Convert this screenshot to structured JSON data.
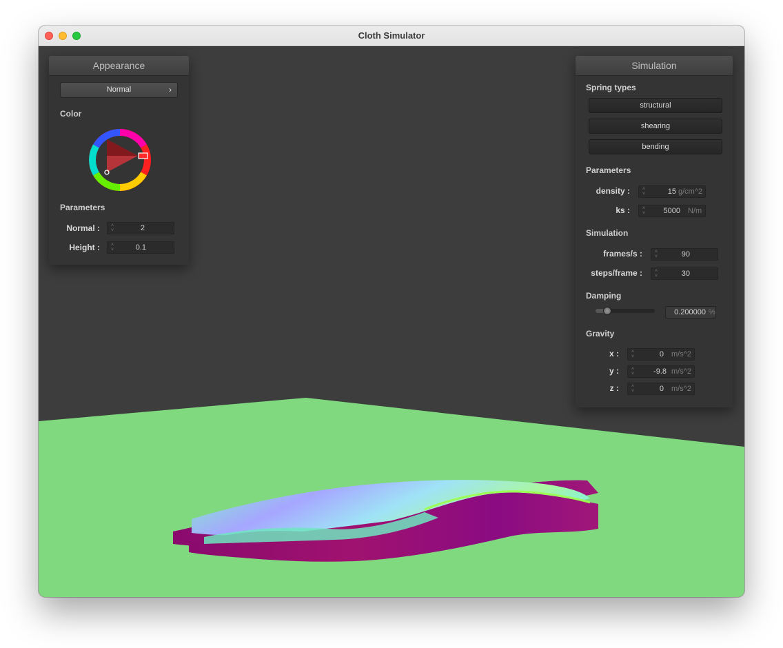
{
  "window": {
    "title": "Cloth Simulator"
  },
  "appearance_panel": {
    "title": "Appearance",
    "shader_dropdown": "Normal",
    "color_label": "Color",
    "parameters_label": "Parameters",
    "normal": {
      "label": "Normal :",
      "value": "2"
    },
    "height": {
      "label": "Height :",
      "value": "0.1"
    }
  },
  "simulation_panel": {
    "title": "Simulation",
    "spring_types_label": "Spring types",
    "spring_buttons": [
      "structural",
      "shearing",
      "bending"
    ],
    "parameters_label": "Parameters",
    "density": {
      "label": "density :",
      "value": "15",
      "unit": "g/cm^2"
    },
    "ks": {
      "label": "ks :",
      "value": "5000",
      "unit": "N/m"
    },
    "simulation_label": "Simulation",
    "frames_per_s": {
      "label": "frames/s :",
      "value": "90"
    },
    "steps_per_frame": {
      "label": "steps/frame :",
      "value": "30"
    },
    "damping_label": "Damping",
    "damping": {
      "value": "0.200000",
      "unit": "%",
      "fraction": 0.2
    },
    "gravity_label": "Gravity",
    "gravity": [
      {
        "label": "x :",
        "value": "0",
        "unit": "m/s^2"
      },
      {
        "label": "y :",
        "value": "-9.8",
        "unit": "m/s^2"
      },
      {
        "label": "z :",
        "value": "0",
        "unit": "m/s^2"
      }
    ]
  },
  "colors": {
    "background": "#3d3d3d",
    "ground": "#80d97f",
    "panel": "#343434",
    "selected_color": "#ff2a2a"
  }
}
